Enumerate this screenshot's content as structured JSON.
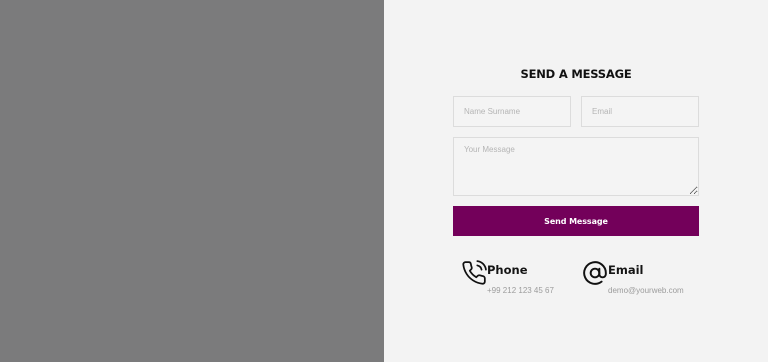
{
  "form": {
    "title": "SEND A MESSAGE",
    "name_placeholder": "Name Surname",
    "email_placeholder": "Email",
    "message_placeholder": "Your Message",
    "submit_label": "Send Message"
  },
  "contacts": [
    {
      "icon": "phone-icon",
      "title": "Phone",
      "value": "+99 212 123 45 67"
    },
    {
      "icon": "at-sign-icon",
      "title": "Email",
      "value": "demo@yourweb.com"
    }
  ],
  "colors": {
    "left_panel": "#7b7b7c",
    "background": "#f3f3f3",
    "accent": "#73005a"
  }
}
